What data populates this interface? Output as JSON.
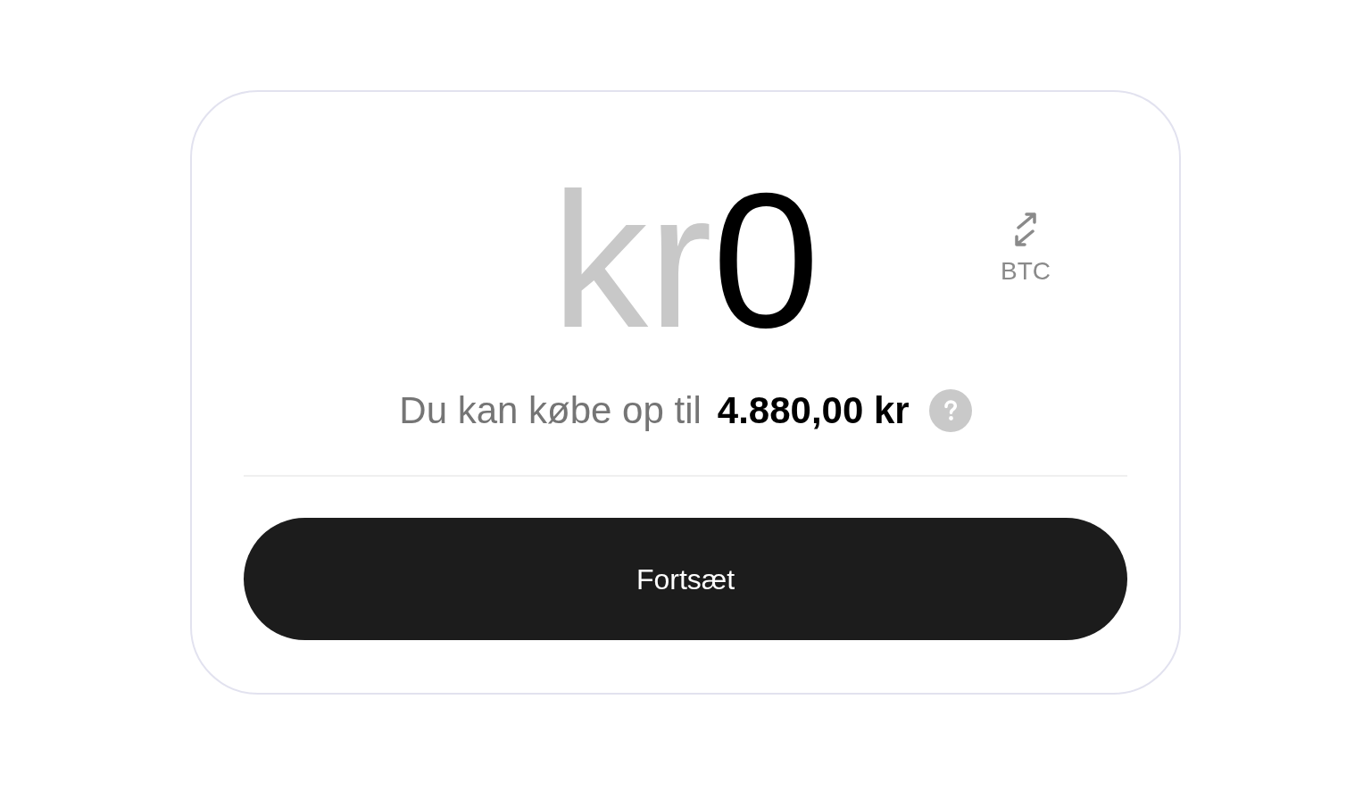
{
  "amount": {
    "currency": "kr",
    "value": "0"
  },
  "unit_toggle": {
    "label": "BTC"
  },
  "limit": {
    "label": "Du kan købe op til",
    "amount": "4.880,00 kr"
  },
  "continue_button": {
    "label": "Fortsæt"
  }
}
